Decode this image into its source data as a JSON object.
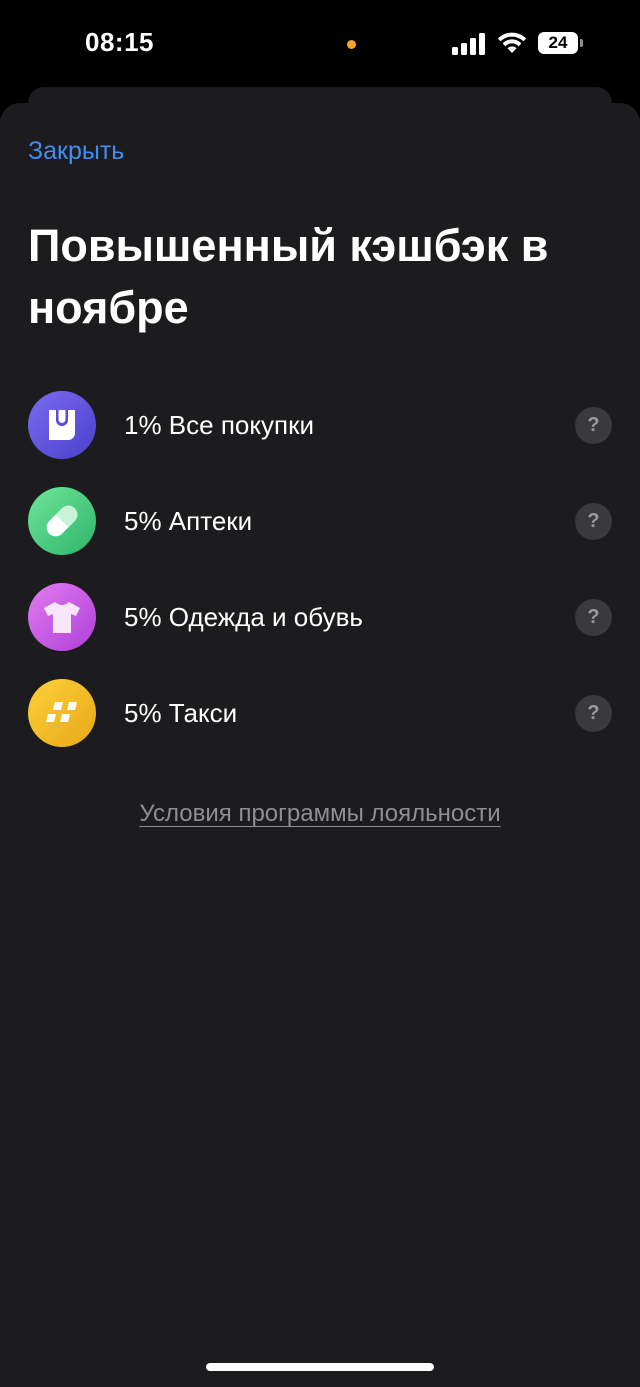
{
  "status_bar": {
    "time": "08:15",
    "battery": "24",
    "dot_color": "#f5a623"
  },
  "sheet": {
    "close_label": "Закрыть",
    "title": "Повышенный кэшбэк в ноябре",
    "help_glyph": "?",
    "categories": [
      {
        "label": "1% Все покупки",
        "icon": "shopping-bag-icon",
        "gradient": [
          "#7b6bf2",
          "#4b3fc9"
        ]
      },
      {
        "label": "5% Аптеки",
        "icon": "pill-icon",
        "gradient": [
          "#6ee79a",
          "#2fb36a"
        ]
      },
      {
        "label": "5% Одежда и обувь",
        "icon": "tshirt-icon",
        "gradient": [
          "#e07cf2",
          "#b03fd6"
        ]
      },
      {
        "label": "5% Такси",
        "icon": "taxi-checker-icon",
        "gradient": [
          "#fcd03a",
          "#e7a817"
        ]
      }
    ],
    "terms_link": "Условия программы лояльности"
  },
  "colors": {
    "accent": "#3f8ef5",
    "sheet_background": "#1c1c1e"
  }
}
